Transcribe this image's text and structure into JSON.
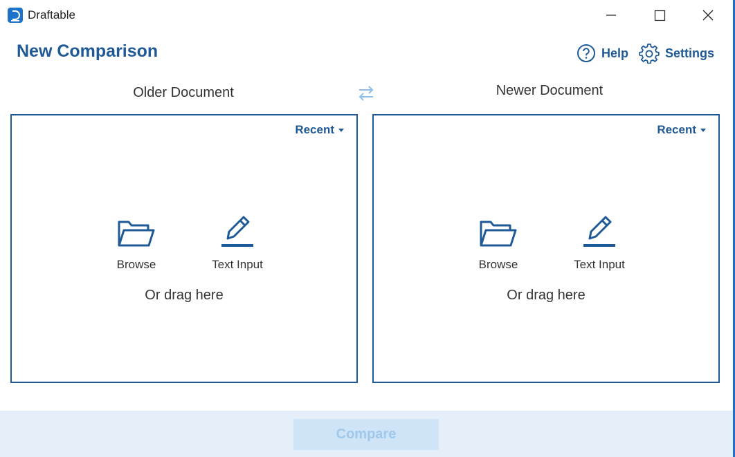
{
  "app": {
    "title": "Draftable",
    "icon": "draftable-logo-icon"
  },
  "window_controls": [
    "minimize-icon",
    "maximize-icon",
    "close-icon"
  ],
  "header": {
    "title": "New Comparison",
    "help_label": "Help",
    "settings_label": "Settings"
  },
  "older": {
    "caption": "Older Document",
    "recent_label": "Recent",
    "browse_label": "Browse",
    "text_input_label": "Text Input",
    "drag_label": "Or drag here"
  },
  "newer": {
    "caption": "Newer Document",
    "recent_label": "Recent",
    "browse_label": "Browse",
    "text_input_label": "Text Input",
    "drag_label": "Or drag here"
  },
  "footer": {
    "compare_label": "Compare",
    "compare_enabled": false
  },
  "colors": {
    "accent": "#1f5a96",
    "swap_icon": "#8cc0ea",
    "footer_bg": "#e4eff9",
    "disabled_button": "#cfe4f6"
  }
}
